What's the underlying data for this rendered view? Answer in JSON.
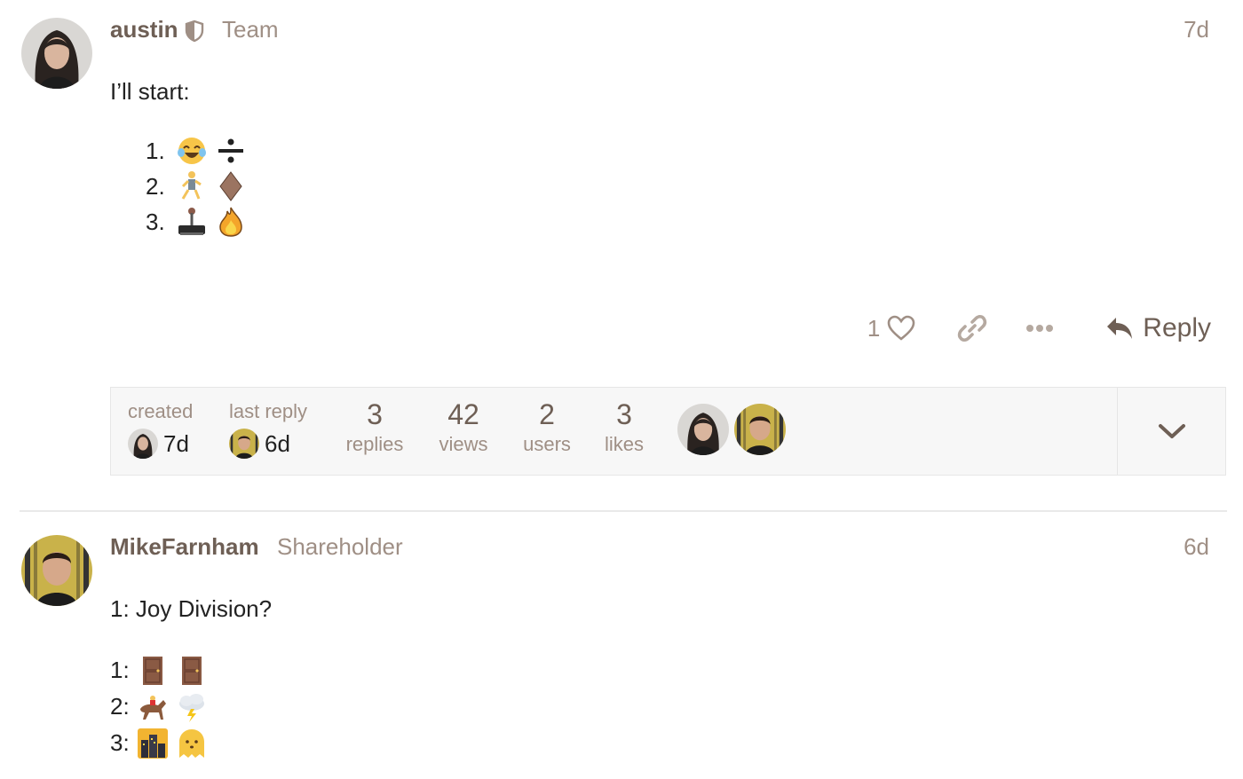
{
  "posts": [
    {
      "username": "austin",
      "user_title": "Team",
      "date": "7d",
      "intro": "I’ll start:",
      "list": [
        {
          "num": "1.",
          "emoji": [
            "face-with-tears-of-joy",
            "division-sign"
          ]
        },
        {
          "num": "2.",
          "emoji": [
            "person-running",
            "brown-diamond"
          ]
        },
        {
          "num": "3.",
          "emoji": [
            "joystick",
            "fire"
          ]
        }
      ],
      "actions": {
        "like_count": "1",
        "reply_label": "Reply"
      },
      "topic_map": {
        "created_label": "created",
        "created_value": "7d",
        "last_reply_label": "last reply",
        "last_reply_value": "6d",
        "replies_count": "3",
        "replies_label": "replies",
        "views_count": "42",
        "views_label": "views",
        "users_count": "2",
        "users_label": "users",
        "likes_count": "3",
        "likes_label": "likes"
      }
    },
    {
      "username": "MikeFarnham",
      "user_title": "Shareholder",
      "date": "6d",
      "intro": "1: Joy Division?",
      "list": [
        {
          "num": "1:",
          "emoji": [
            "door",
            "door"
          ]
        },
        {
          "num": "2:",
          "emoji": [
            "horse-racing",
            "cloud-with-lightning"
          ]
        },
        {
          "num": "3:",
          "emoji": [
            "city-at-night",
            "ghost"
          ]
        }
      ]
    }
  ],
  "colors": {
    "username": "#6e5f55",
    "muted": "#9f8f85",
    "text": "#222222",
    "topic_map_bg": "#f7f7f7"
  }
}
